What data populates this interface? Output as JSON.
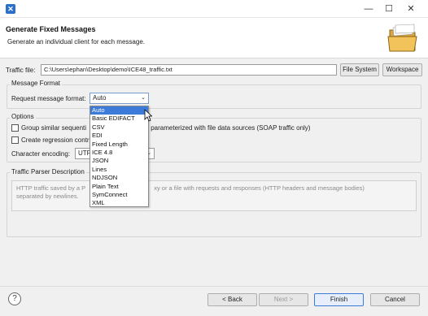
{
  "titlebar": {
    "minimize": "—",
    "maximize": "☐",
    "close": "✕"
  },
  "header": {
    "title": "Generate Fixed Messages",
    "description": "Generate an individual client for each message."
  },
  "traffic_file": {
    "label": "Traffic file:",
    "value": "C:\\Users\\ephan\\Desktop\\demo\\ICE48_traffic.txt",
    "file_system_button": "File System",
    "workspace_button": "Workspace"
  },
  "message_format": {
    "group_title": "Message Format",
    "request_label": "Request message format:",
    "selected": "Auto",
    "options": [
      "Auto",
      "Basic EDIFACT",
      "CSV",
      "EDI",
      "Fixed Length",
      "ICE 4.8",
      "JSON",
      "Lines",
      "NDJSON",
      "Plain Text",
      "SymConnect",
      "XML"
    ]
  },
  "options": {
    "group_title": "Options",
    "group_similar_label": "Group similar sequenti",
    "group_similar_suffix": "s parameterized with file data sources (SOAP traffic only)",
    "regression_label": "Create regression contr",
    "encoding_label": "Character encoding:",
    "encoding_value": "UTF"
  },
  "parser": {
    "group_title": "Traffic Parser Description",
    "desc_line1_a": "HTTP traffic saved by a P",
    "desc_line1_b": "xy or a file with requests and responses (HTTP headers and message bodies)",
    "desc_line2": "separated by newlines."
  },
  "footer": {
    "help": "?",
    "back": "< Back",
    "next": "Next >",
    "finish": "Finish",
    "cancel": "Cancel"
  },
  "colors": {
    "accent": "#3d7bd9",
    "app_icon": "#2a6fc9"
  }
}
